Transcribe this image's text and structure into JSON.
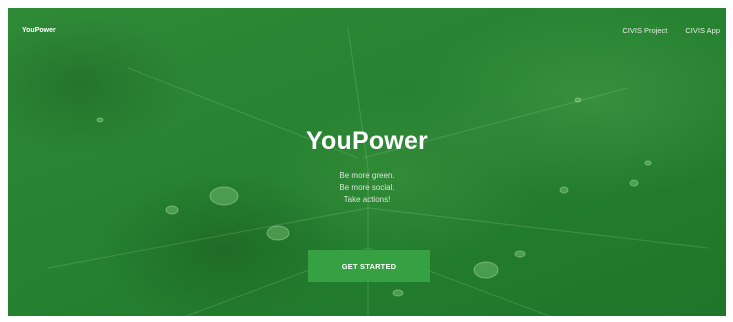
{
  "nav": {
    "brand": "YouPower",
    "links": [
      {
        "label": "CIVIS Project"
      },
      {
        "label": "CIVIS App"
      }
    ]
  },
  "hero": {
    "title": "YouPower",
    "taglines": [
      "Be more green.",
      "Be more social.",
      "Take actions!"
    ],
    "cta_label": "GET STARTED"
  },
  "colors": {
    "background_green": "#268231",
    "cta_green": "#35a143",
    "text": "#ffffff"
  }
}
